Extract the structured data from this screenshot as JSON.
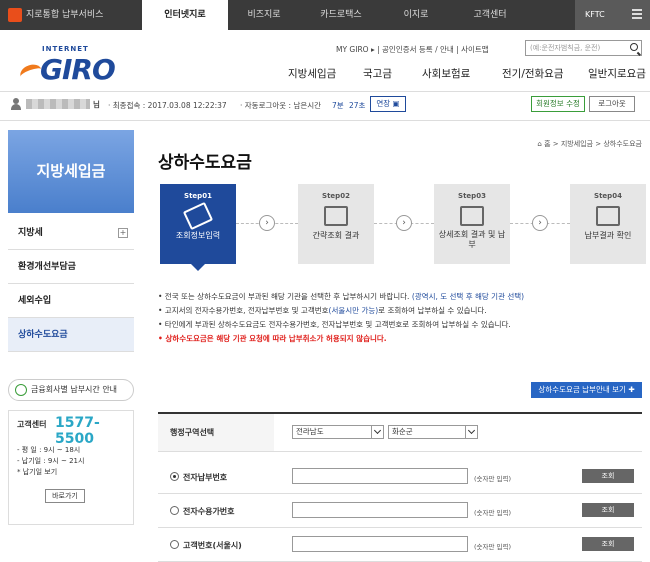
{
  "topbar": {
    "tabs": [
      {
        "label": "지로통합 납부서비스",
        "active": false
      },
      {
        "label": "인터넷지로",
        "active": true
      },
      {
        "label": "비즈지로",
        "active": false
      },
      {
        "label": "카드로택스",
        "active": false
      },
      {
        "label": "이지로",
        "active": false
      },
      {
        "label": "고객센터",
        "active": false
      }
    ],
    "org": "KFTC"
  },
  "logo": {
    "small": "INTERNET",
    "big": "GIRO"
  },
  "util": {
    "links": "MY GIRO  ▸  | 공인인증서 등록 / 안내 | 사이트맵",
    "search_placeholder": "(예:운전자범칙금, 운전)"
  },
  "gnb": [
    "지방세입금",
    "국고금",
    "사회보험료",
    "전기/전화요금",
    "일반지로요금"
  ],
  "userbar": {
    "suffix": "님",
    "last_login": "· 최종접속 : 2017.03.08 12:22:37",
    "auto_logout": "· 자동로그아웃 : 남은시간",
    "time_min": "7분",
    "time_sec": "27초",
    "extend": "연장 ▣",
    "edit_btn": "회원정보 수정",
    "logout_btn": "로그아웃"
  },
  "sidebar": {
    "title": "지방세입금",
    "items": [
      "지방세",
      "환경개선부담금",
      "세외수입",
      "상하수도요금"
    ],
    "active_index": 3,
    "hours_label": "금융회사별 납부시간 안내",
    "hours_highlight": "금융회사별",
    "call_label": "고객센터",
    "call_number": "1577-5500",
    "hours_lines": [
      "- 평  일 : 9시 ~ 18시",
      "- 납기일 : 9시 ~ 21시",
      "  * 납기일 보기"
    ],
    "more_btn": "바로가기"
  },
  "main": {
    "title": "상하수도요금",
    "breadcrumb": "홈 > 지방세입금 > 상하수도요금",
    "steps": [
      {
        "num": "Step01",
        "label": "조회정보입력",
        "active": true
      },
      {
        "num": "Step02",
        "label": "간략조회 결과",
        "active": false
      },
      {
        "num": "Step03",
        "label": "상세조회 결과 및 납부",
        "active": false
      },
      {
        "num": "Step04",
        "label": "납부결과 확인",
        "active": false
      }
    ],
    "notes": [
      {
        "pre": "• 전국 또는 상하수도요금이 부과된 해당 기관을 선택한 후 납부하시기 바랍니다.",
        "blue": "(광역시, 도 선택 후 해당 기관 선택)",
        "post": ""
      },
      {
        "pre": "• 고지서의 전자수용가번호, 전자납부번호 및 고객번호",
        "blue": "(서울시만 가능)",
        "post": "로 조회하여 납부하실 수 있습니다."
      },
      {
        "pre": "• 타인에게 부과된 상하수도요금도 전자수용가번호, 전자납부번호 및 고객번호로 조회하여 납부하실 수 있습니다.",
        "blue": "",
        "post": ""
      }
    ],
    "note_red": "• 상하수도요금은 해당 기관 요청에 따라 납부취소가 허용되지 않습니다.",
    "guide_btn": "상하수도요금 납부안내 보기  ✚"
  },
  "form": {
    "region_label": "행정구역선택",
    "region_values": [
      "전라남도",
      "화순군"
    ],
    "rows": [
      {
        "label": "전자납부번호",
        "checked": true,
        "hint": "(숫자만 입력)",
        "btn": "조회"
      },
      {
        "label": "전자수용가번호",
        "checked": false,
        "hint": "(숫자만 입력)",
        "btn": "조회"
      },
      {
        "label": "고객번호(서울시)",
        "checked": false,
        "hint": "(숫자만 입력)",
        "btn": "조회"
      }
    ]
  }
}
